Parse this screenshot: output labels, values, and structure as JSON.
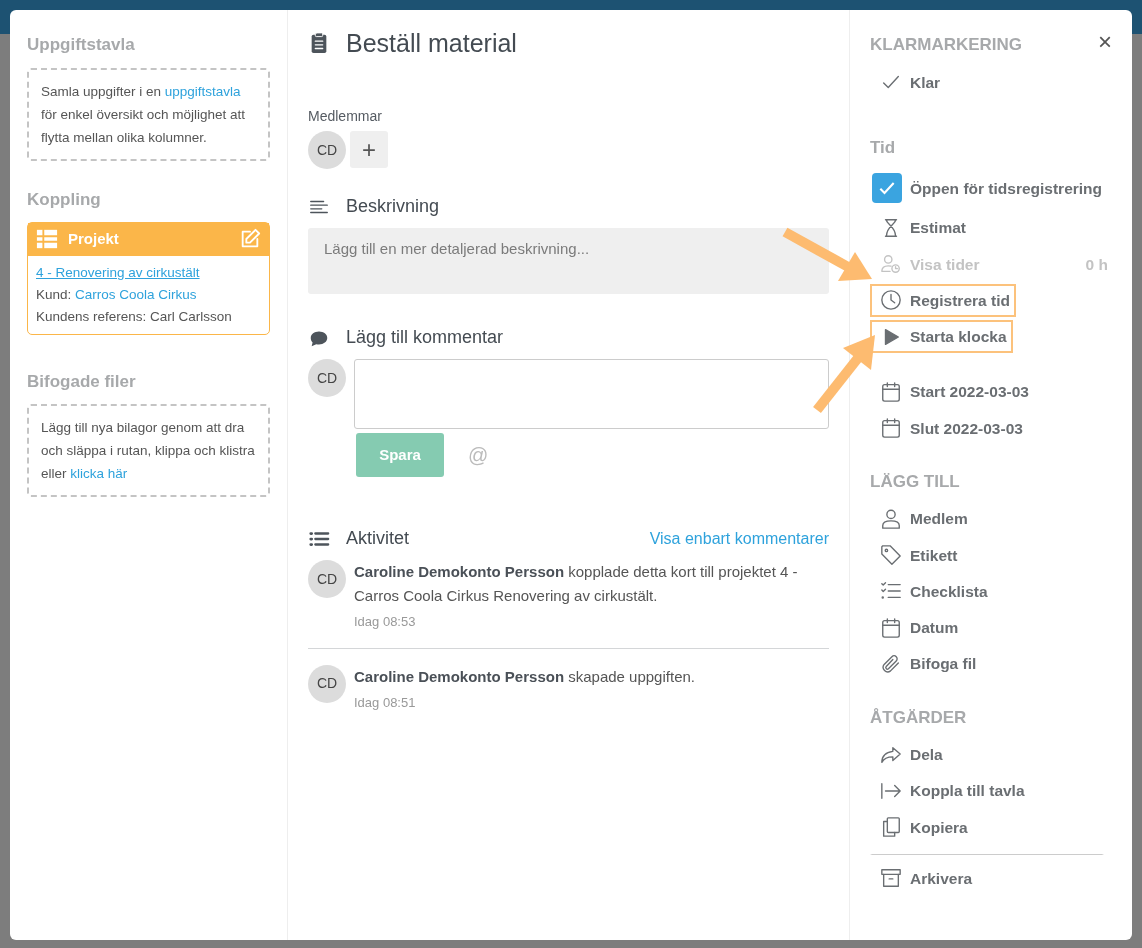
{
  "left": {
    "board": {
      "title": "Uppgiftstavla",
      "text_before": "Samla uppgifter i en ",
      "link": "uppgiftstavla",
      "text_after": " för enkel översikt och möjlighet att flytta mellan olika kolumner."
    },
    "connection": {
      "title": "Koppling",
      "card_title": "Projekt",
      "project_link": "4 - Renovering av cirkustält",
      "customer_label": "Kund:",
      "customer": "Carros Coola Cirkus",
      "reference": "Kundens referens: Carl Carlsson"
    },
    "attachments": {
      "title": "Bifogade filer",
      "text_before": "Lägg till nya bilagor genom att dra och släppa i rutan, klippa och klistra eller ",
      "link": "klicka här"
    }
  },
  "main": {
    "title": "Beställ material",
    "members_label": "Medlemmar",
    "members": [
      "CD"
    ],
    "add_member": "+",
    "description": {
      "heading": "Beskrivning",
      "placeholder": "Lägg till en mer detaljerad beskrivning..."
    },
    "comment": {
      "heading": "Lägg till kommentar",
      "avatar": "CD",
      "save": "Spara",
      "save_disabled": true,
      "mention": "@"
    },
    "activity": {
      "heading": "Aktivitet",
      "filter_link": "Visa enbart kommentarer",
      "entries": [
        {
          "avatar": "CD",
          "author": "Caroline Demokonto Persson",
          "text": "kopplade detta kort till projektet 4 - Carros Coola Cirkus  Renovering av cirkustält.",
          "time": "Idag 08:53"
        },
        {
          "avatar": "CD",
          "author": "Caroline Demokonto Persson",
          "text": "skapade uppgiften.",
          "time": "Idag 08:51"
        }
      ]
    }
  },
  "side": {
    "close": "×",
    "sections": [
      {
        "title": "KLARMARKERING",
        "items": [
          {
            "kind": "action",
            "label": "Klar"
          }
        ]
      },
      {
        "title": "Tid",
        "items": [
          {
            "kind": "checkbox",
            "label": "Öppen för tidsregistrering",
            "checked": true,
            "disabled": false,
            "highlighted": false
          },
          {
            "kind": "action",
            "label": "Estimat",
            "disabled": false,
            "highlighted": false
          },
          {
            "kind": "action",
            "label": "Visa tider",
            "value": "0 h",
            "disabled": true,
            "highlighted": false
          },
          {
            "kind": "action",
            "label": "Registrera tid",
            "disabled": false,
            "highlighted": true
          },
          {
            "kind": "action",
            "label": "Starta klocka",
            "disabled": false,
            "highlighted": true
          }
        ]
      },
      {
        "items": [
          {
            "kind": "action",
            "label": "Start 2022-03-03"
          },
          {
            "kind": "action",
            "label": "Slut 2022-03-03"
          }
        ]
      },
      {
        "title": "LÄGG TILL",
        "items": [
          {
            "kind": "action",
            "label": "Medlem"
          },
          {
            "kind": "action",
            "label": "Etikett"
          },
          {
            "kind": "action",
            "label": "Checklista"
          },
          {
            "kind": "action",
            "label": "Datum"
          },
          {
            "kind": "action",
            "label": "Bifoga fil"
          }
        ]
      },
      {
        "title": "ÅTGÄRDER",
        "items": [
          {
            "kind": "action",
            "label": "Dela",
            "divider_before": false
          },
          {
            "kind": "action",
            "label": "Koppla till tavla",
            "divider_before": false
          },
          {
            "kind": "action",
            "label": "Kopiera",
            "divider_before": false
          },
          {
            "kind": "action",
            "label": "Arkivera",
            "divider_before": true
          }
        ]
      }
    ]
  }
}
